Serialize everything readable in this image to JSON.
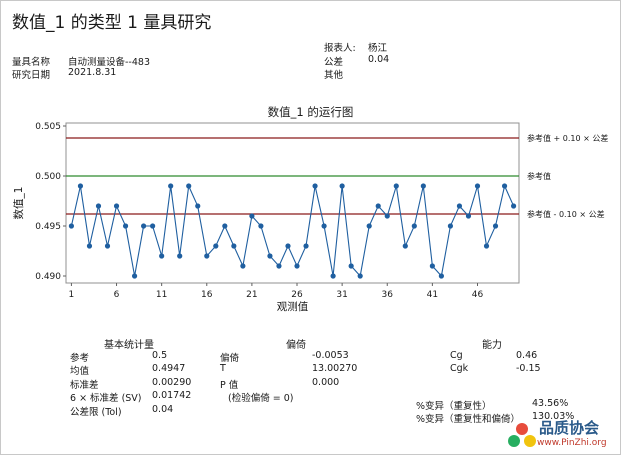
{
  "report": {
    "title": "数值_1 的类型 1 量具研究",
    "gauge_name_label": "量具名称",
    "gauge_name": "自动测量设备--483",
    "study_date_label": "研究日期",
    "study_date": "2021.8.31",
    "reporter_label": "报表人:",
    "reporter": "杨江",
    "tolerance_label": "公差",
    "tolerance": "0.04",
    "other_label": "其他",
    "other": ""
  },
  "chart_data": {
    "type": "line",
    "title": "数值_1 的运行图",
    "xlabel": "观测值",
    "ylabel": "数值_1",
    "x_ticks": [
      1,
      6,
      11,
      16,
      21,
      26,
      31,
      36,
      41,
      46
    ],
    "y_ticks": [
      "0.490",
      "0.495",
      "0.500",
      "0.505"
    ],
    "ylim": [
      0.4893,
      0.5053
    ],
    "xlim": [
      0.4,
      50.6
    ],
    "series": [
      {
        "color": "#1f5fa0",
        "values": [
          0.495,
          0.499,
          0.493,
          0.497,
          0.493,
          0.497,
          0.495,
          0.49,
          0.495,
          0.495,
          0.492,
          0.499,
          0.492,
          0.499,
          0.497,
          0.492,
          0.493,
          0.495,
          0.493,
          0.491,
          0.496,
          0.495,
          0.492,
          0.491,
          0.493,
          0.491,
          0.493,
          0.499,
          0.495,
          0.49,
          0.499,
          0.491,
          0.49,
          0.495,
          0.497,
          0.496,
          0.499,
          0.493,
          0.495,
          0.499,
          0.491,
          0.49,
          0.495,
          0.497,
          0.496,
          0.499,
          0.493,
          0.495,
          0.499,
          0.497
        ]
      }
    ],
    "reference_lines": [
      {
        "value": 0.5038,
        "color": "#8b1a1a",
        "label": "参考值 + 0.10 × 公差"
      },
      {
        "value": 0.5,
        "color": "#2e8b2e",
        "label": "参考值"
      },
      {
        "value": 0.4962,
        "color": "#8b1a1a",
        "label": "参考值 - 0.10 × 公差"
      }
    ]
  },
  "stats": {
    "basic_header": "基本统计量",
    "bias_header": "偏倚",
    "capability_header": "能力",
    "ref_label": "参考",
    "ref": "0.5",
    "mean_label": "均值",
    "mean": "0.4947",
    "sd_label": "标准差",
    "sd": "0.00290",
    "sv_label": "6 × 标准差 (SV)",
    "sv": "0.01742",
    "tol_label": "公差限 (Tol)",
    "tol": "0.04",
    "bias_label": "偏倚",
    "bias": "-0.0053",
    "t_label": "T",
    "t": "13.00270",
    "p_label": "P 值",
    "p": "0.000",
    "test_note": "(检验偏倚 = 0)",
    "cg_label": "Cg",
    "cg": "0.46",
    "cgk_label": "Cgk",
    "cgk": "-0.15",
    "var_rep_label": "%变异（重复性）",
    "var_rep": "43.56%",
    "var_rep_bias_label": "%变异（重复性和偏倚）",
    "var_rep_bias": "130.03%"
  },
  "watermark": {
    "name": "品质协会",
    "url": "www.PinZhi.org"
  }
}
